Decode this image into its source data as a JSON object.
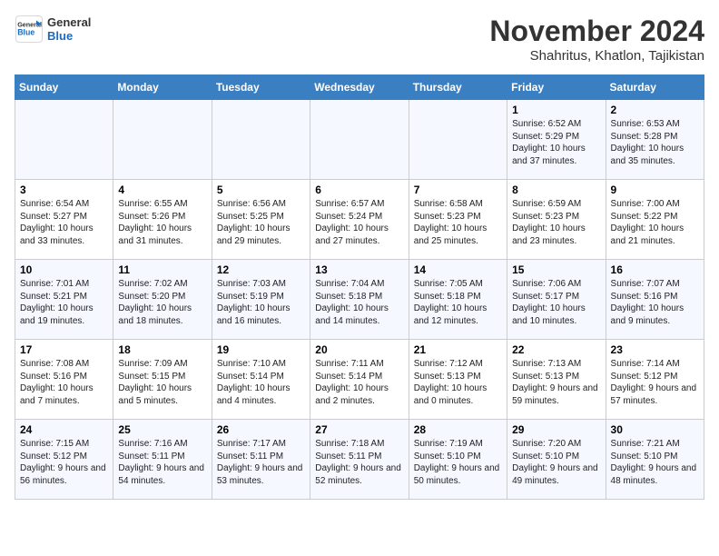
{
  "logo": {
    "general": "General",
    "blue": "Blue"
  },
  "title": "November 2024",
  "subtitle": "Shahritus, Khatlon, Tajikistan",
  "days_header": [
    "Sunday",
    "Monday",
    "Tuesday",
    "Wednesday",
    "Thursday",
    "Friday",
    "Saturday"
  ],
  "weeks": [
    [
      {
        "day": "",
        "info": ""
      },
      {
        "day": "",
        "info": ""
      },
      {
        "day": "",
        "info": ""
      },
      {
        "day": "",
        "info": ""
      },
      {
        "day": "",
        "info": ""
      },
      {
        "day": "1",
        "info": "Sunrise: 6:52 AM\nSunset: 5:29 PM\nDaylight: 10 hours and 37 minutes."
      },
      {
        "day": "2",
        "info": "Sunrise: 6:53 AM\nSunset: 5:28 PM\nDaylight: 10 hours and 35 minutes."
      }
    ],
    [
      {
        "day": "3",
        "info": "Sunrise: 6:54 AM\nSunset: 5:27 PM\nDaylight: 10 hours and 33 minutes."
      },
      {
        "day": "4",
        "info": "Sunrise: 6:55 AM\nSunset: 5:26 PM\nDaylight: 10 hours and 31 minutes."
      },
      {
        "day": "5",
        "info": "Sunrise: 6:56 AM\nSunset: 5:25 PM\nDaylight: 10 hours and 29 minutes."
      },
      {
        "day": "6",
        "info": "Sunrise: 6:57 AM\nSunset: 5:24 PM\nDaylight: 10 hours and 27 minutes."
      },
      {
        "day": "7",
        "info": "Sunrise: 6:58 AM\nSunset: 5:23 PM\nDaylight: 10 hours and 25 minutes."
      },
      {
        "day": "8",
        "info": "Sunrise: 6:59 AM\nSunset: 5:23 PM\nDaylight: 10 hours and 23 minutes."
      },
      {
        "day": "9",
        "info": "Sunrise: 7:00 AM\nSunset: 5:22 PM\nDaylight: 10 hours and 21 minutes."
      }
    ],
    [
      {
        "day": "10",
        "info": "Sunrise: 7:01 AM\nSunset: 5:21 PM\nDaylight: 10 hours and 19 minutes."
      },
      {
        "day": "11",
        "info": "Sunrise: 7:02 AM\nSunset: 5:20 PM\nDaylight: 10 hours and 18 minutes."
      },
      {
        "day": "12",
        "info": "Sunrise: 7:03 AM\nSunset: 5:19 PM\nDaylight: 10 hours and 16 minutes."
      },
      {
        "day": "13",
        "info": "Sunrise: 7:04 AM\nSunset: 5:18 PM\nDaylight: 10 hours and 14 minutes."
      },
      {
        "day": "14",
        "info": "Sunrise: 7:05 AM\nSunset: 5:18 PM\nDaylight: 10 hours and 12 minutes."
      },
      {
        "day": "15",
        "info": "Sunrise: 7:06 AM\nSunset: 5:17 PM\nDaylight: 10 hours and 10 minutes."
      },
      {
        "day": "16",
        "info": "Sunrise: 7:07 AM\nSunset: 5:16 PM\nDaylight: 10 hours and 9 minutes."
      }
    ],
    [
      {
        "day": "17",
        "info": "Sunrise: 7:08 AM\nSunset: 5:16 PM\nDaylight: 10 hours and 7 minutes."
      },
      {
        "day": "18",
        "info": "Sunrise: 7:09 AM\nSunset: 5:15 PM\nDaylight: 10 hours and 5 minutes."
      },
      {
        "day": "19",
        "info": "Sunrise: 7:10 AM\nSunset: 5:14 PM\nDaylight: 10 hours and 4 minutes."
      },
      {
        "day": "20",
        "info": "Sunrise: 7:11 AM\nSunset: 5:14 PM\nDaylight: 10 hours and 2 minutes."
      },
      {
        "day": "21",
        "info": "Sunrise: 7:12 AM\nSunset: 5:13 PM\nDaylight: 10 hours and 0 minutes."
      },
      {
        "day": "22",
        "info": "Sunrise: 7:13 AM\nSunset: 5:13 PM\nDaylight: 9 hours and 59 minutes."
      },
      {
        "day": "23",
        "info": "Sunrise: 7:14 AM\nSunset: 5:12 PM\nDaylight: 9 hours and 57 minutes."
      }
    ],
    [
      {
        "day": "24",
        "info": "Sunrise: 7:15 AM\nSunset: 5:12 PM\nDaylight: 9 hours and 56 minutes."
      },
      {
        "day": "25",
        "info": "Sunrise: 7:16 AM\nSunset: 5:11 PM\nDaylight: 9 hours and 54 minutes."
      },
      {
        "day": "26",
        "info": "Sunrise: 7:17 AM\nSunset: 5:11 PM\nDaylight: 9 hours and 53 minutes."
      },
      {
        "day": "27",
        "info": "Sunrise: 7:18 AM\nSunset: 5:11 PM\nDaylight: 9 hours and 52 minutes."
      },
      {
        "day": "28",
        "info": "Sunrise: 7:19 AM\nSunset: 5:10 PM\nDaylight: 9 hours and 50 minutes."
      },
      {
        "day": "29",
        "info": "Sunrise: 7:20 AM\nSunset: 5:10 PM\nDaylight: 9 hours and 49 minutes."
      },
      {
        "day": "30",
        "info": "Sunrise: 7:21 AM\nSunset: 5:10 PM\nDaylight: 9 hours and 48 minutes."
      }
    ]
  ]
}
